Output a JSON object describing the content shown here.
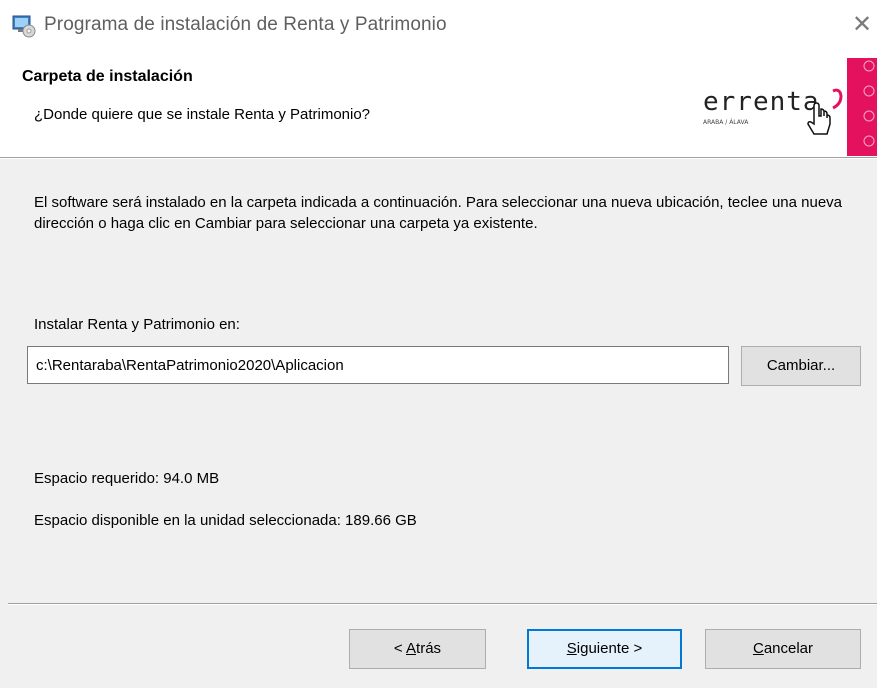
{
  "window": {
    "title": "Programa de instalación de Renta y Patrimonio",
    "close_glyph": "✕",
    "app_icon": "installer-icon",
    "close_icon": "close-icon"
  },
  "header": {
    "title": "Carpeta de instalación",
    "subtitle": "¿Donde quiere que se instale Renta y Patrimonio?",
    "logo": {
      "brand": "errenta",
      "tagline": "ARABA / ÁLAVA",
      "icon": "hand-pointer-icon",
      "accent_color": "#e4125e"
    }
  },
  "body": {
    "description": "El software será instalado en la carpeta indicada a continuación. Para seleccionar una nueva ubicación, teclee una nueva dirección o haga clic en Cambiar para seleccionar una carpeta ya existente.",
    "install_label": "Instalar Renta y Patrimonio en:",
    "install_path": "c:\\Rentaraba\\RentaPatrimonio2020\\Aplicacion",
    "change_button": "Cambiar...",
    "required_space": "Espacio requerido: 94.0 MB",
    "available_space": "Espacio disponible en la unidad seleccionada: 189.66 GB"
  },
  "footer": {
    "back": {
      "prefix": "< ",
      "mnemonic": "A",
      "rest": "trás"
    },
    "next": {
      "mnemonic": "S",
      "rest": "iguiente >"
    },
    "cancel": {
      "mnemonic": "C",
      "rest": "ancelar"
    }
  },
  "colors": {
    "dialog_bg": "#f0f0f0",
    "header_bg": "#ffffff",
    "focus_border": "#0078d7",
    "brand_pink": "#e4125e"
  }
}
